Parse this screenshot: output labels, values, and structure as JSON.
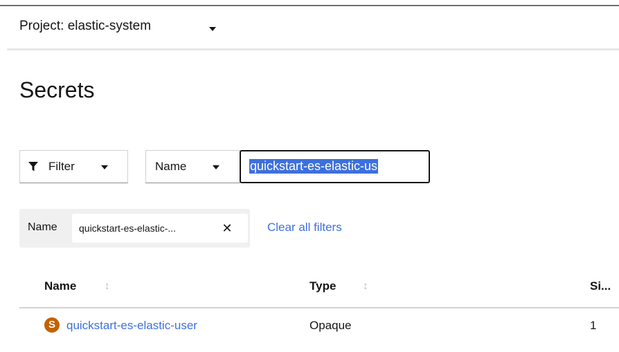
{
  "project": {
    "label": "Project: elastic-system"
  },
  "page": {
    "title": "Secrets"
  },
  "toolbar": {
    "filter_label": "Filter",
    "attribute_label": "Name",
    "search_value": "quickstart-es-elastic-us"
  },
  "chips": {
    "group_label": "Name",
    "chip_text": "quickstart-es-elastic-...",
    "close_glyph": "✕",
    "clear_all": "Clear all filters"
  },
  "table": {
    "columns": [
      "Name",
      "Type",
      "Si..."
    ],
    "sort_glyph": "↕",
    "rows": [
      {
        "badge": "S",
        "name": "quickstart-es-elastic-user",
        "type": "Opaque",
        "size": "1"
      }
    ]
  },
  "icons": {
    "project_dropdown": "caret-down-icon",
    "filter": "funnel-icon",
    "close": "close-icon",
    "sort": "sort-icon"
  },
  "colors": {
    "link": "#3d70dd",
    "badge": "#c46100",
    "selection": "#3d70dd"
  }
}
